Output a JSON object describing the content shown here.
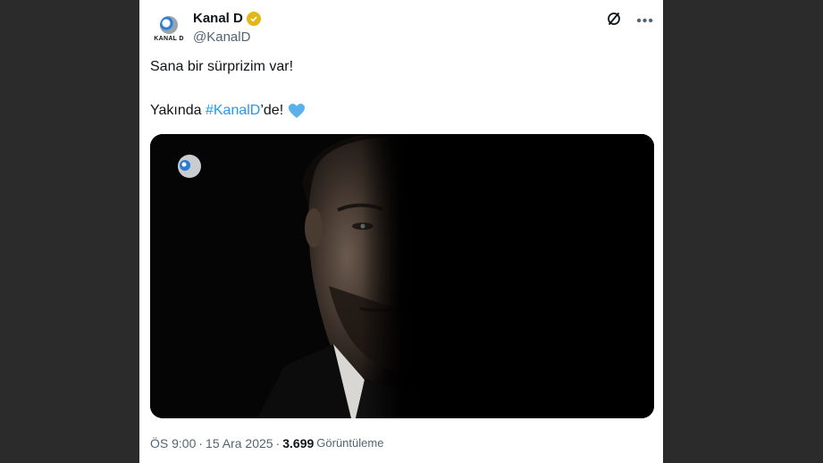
{
  "account": {
    "name": "Kanal D",
    "handle": "@KanalD",
    "avatar_text": "KANAL D"
  },
  "tweet": {
    "line1": "Sana bir sürprizim var!",
    "line2_prefix": "Yakında ",
    "hashtag": "#KanalD",
    "line2_suffix": "’de!"
  },
  "meta": {
    "time": "ÖS 9:00",
    "separator": "·",
    "date": "15 Ara 2025",
    "views_count": "3.699",
    "views_label": "Görüntüleme"
  },
  "colors": {
    "accent": "#1d9bf0",
    "verified": "#e2b719",
    "background": "#2b2b2b"
  },
  "icons": {
    "verified": "verified-badge-icon",
    "grok": "grok-icon",
    "more": "more-icon",
    "heart": "blue-heart-icon",
    "media_logo": "kanal-d-logo-icon"
  }
}
